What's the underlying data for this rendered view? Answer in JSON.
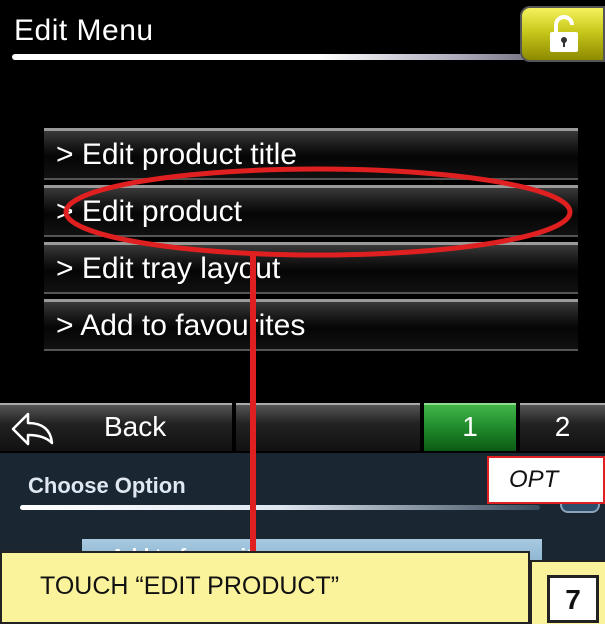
{
  "header": {
    "title": "Edit Menu",
    "lock_icon": "unlock-icon"
  },
  "menu": {
    "items": [
      {
        "label": "> Edit product title"
      },
      {
        "label": "> Edit product"
      },
      {
        "label": "> Edit tray layout"
      },
      {
        "label": "> Add to favourites"
      }
    ]
  },
  "bottom_bar": {
    "back_label": "Back",
    "back_icon": "back-arrow-icon",
    "page_1": "1",
    "page_2": "2",
    "active_page_color": "#1f8a2a"
  },
  "lower_screen": {
    "title": "Choose Option",
    "item_label": "> Add to favourites"
  },
  "annotations": {
    "option_label": "OPT",
    "instruction": "TOUCH “EDIT PRODUCT”",
    "step_number": "7",
    "highlight_color": "#e02020",
    "callout_color": "#fbf39c"
  }
}
